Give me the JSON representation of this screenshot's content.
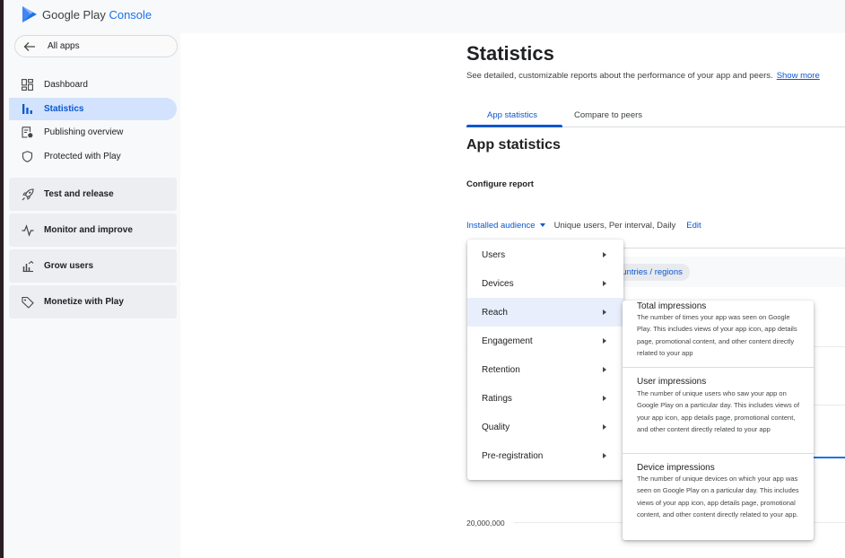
{
  "header": {
    "logo_google_play": "Google Play",
    "logo_console": "Console"
  },
  "sidebar": {
    "back_label": "All apps",
    "items": [
      {
        "label": "Dashboard",
        "icon": "dashboard-icon"
      },
      {
        "label": "Statistics",
        "icon": "bar-chart-icon",
        "active": true
      },
      {
        "label": "Publishing overview",
        "icon": "publishing-icon"
      },
      {
        "label": "Protected with Play",
        "icon": "shield-icon"
      }
    ],
    "groups": [
      {
        "label": "Test and release",
        "icon": "rocket-icon"
      },
      {
        "label": "Monitor and improve",
        "icon": "pulse-icon"
      },
      {
        "label": "Grow users",
        "icon": "grow-users-icon"
      },
      {
        "label": "Monetize with Play",
        "icon": "tag-icon"
      }
    ]
  },
  "main": {
    "title": "Statistics",
    "subtitle": "See detailed, customizable reports about the performance of your app and peers.",
    "show_more": "Show more",
    "tabs": [
      {
        "label": "App statistics",
        "active": true
      },
      {
        "label": "Compare to peers"
      }
    ],
    "section_title": "App statistics",
    "configure_label": "Configure report",
    "filter": {
      "metric": "Installed audience",
      "description": "Unique users, Per interval, Daily",
      "edit": "Edit"
    },
    "chip_label": "ountries / regions",
    "axis_label": "20,000,000"
  },
  "menu": {
    "items": [
      "Users",
      "Devices",
      "Reach",
      "Engagement",
      "Retention",
      "Ratings",
      "Quality",
      "Pre-registration"
    ],
    "active": "Reach"
  },
  "submenu": {
    "items": [
      {
        "title": "Total impressions",
        "desc": "The number of times your app was seen on Google Play. This includes views of your app icon, app details page, promotional content, and other content directly related to your app"
      },
      {
        "title": "User impressions",
        "desc": "The number of unique users who saw your app on Google Play on a particular day. This includes views of your app icon, app details page, promotional content, and other content directly related to your app"
      },
      {
        "title": "Device impressions",
        "desc": "The number of unique devices on which your app was seen on Google Play on a particular day. This includes views of your app icon, app details page, promotional content, and other content directly related to your app."
      }
    ]
  },
  "colors": {
    "accent": "#0b57d0",
    "active_nav": "#d3e3fd",
    "menu_active": "#e8eefb"
  }
}
